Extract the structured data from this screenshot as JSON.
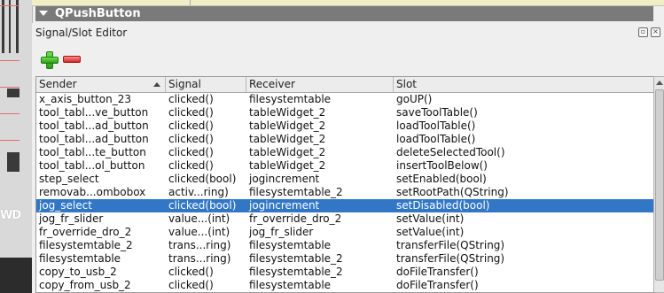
{
  "header_bar": {
    "title": "QPushButton"
  },
  "left_strip": {
    "text": "WD"
  },
  "dock": {
    "title": "Signal/Slot Editor",
    "float_icon": "restore-icon",
    "close_icon": "close-icon"
  },
  "toolbar": {
    "add_icon": "plus-icon",
    "remove_icon": "minus-icon"
  },
  "table": {
    "headers": [
      "Sender",
      "Signal",
      "Receiver",
      "Slot"
    ],
    "selected_index": 8,
    "rows": [
      [
        "x_axis_button_23",
        "clicked()",
        "filesystemtable",
        "goUP()"
      ],
      [
        "tool_tabl...ve_button",
        "clicked()",
        "tableWidget_2",
        "saveToolTable()"
      ],
      [
        "tool_tabl...ad_button",
        "clicked()",
        "tableWidget_2",
        "loadToolTable()"
      ],
      [
        "tool_tabl...ad_button",
        "clicked()",
        "tableWidget_2",
        "loadToolTable()"
      ],
      [
        "tool_tabl...te_button",
        "clicked()",
        "tableWidget_2",
        "deleteSelectedTool()"
      ],
      [
        "tool_tabl...ol_button",
        "clicked()",
        "tableWidget_2",
        "insertToolBelow()"
      ],
      [
        "step_select",
        "clicked(bool)",
        "jogincrement",
        "setEnabled(bool)"
      ],
      [
        "removab...ombobox",
        "activ...ring)",
        "filesystemtable_2",
        "setRootPath(QString)"
      ],
      [
        "jog_select",
        "clicked(bool)",
        "jogincrement",
        "setDisabled(bool)"
      ],
      [
        "jog_fr_slider",
        "value...(int)",
        "fr_override_dro_2",
        "setValue(int)"
      ],
      [
        "fr_override_dro_2",
        "value...(int)",
        "jog_fr_slider",
        "setValue(int)"
      ],
      [
        "filesystemtable_2",
        "trans...ring)",
        "filesystemtable",
        "transferFile(QString)"
      ],
      [
        "filesystemtable",
        "trans...ring)",
        "filesystemtable_2",
        "transferFile(QString)"
      ],
      [
        "copy_to_usb_2",
        "clicked()",
        "filesystemtable_2",
        "doFileTransfer()"
      ],
      [
        "copy_from_usb_2",
        "clicked()",
        "filesystemtable",
        "doFileTransfer()"
      ]
    ]
  },
  "colors": {
    "selection": "#3177c6",
    "header_bar": "#7a7a7a"
  }
}
